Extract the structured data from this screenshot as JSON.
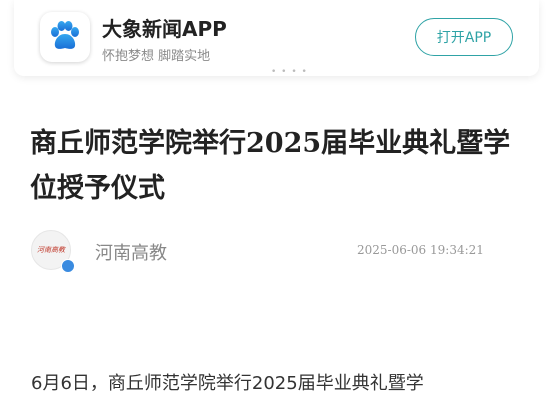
{
  "banner": {
    "app_name": "大象新闻APP",
    "slogan": "怀抱梦想 脚踏实地",
    "open_button": "打开APP",
    "logo_icon": "paw-icon",
    "brand_color": "#2fa3a6"
  },
  "article": {
    "title": "商丘师范学院举行2025届毕业典礼暨学位授予仪式",
    "author": "河南高教",
    "author_avatar_text": "河南高教",
    "publish_time": "2025-06-06 19:34:21",
    "body_first_line": "6月6日，商丘师范学院举行2025届毕业典礼暨学"
  }
}
